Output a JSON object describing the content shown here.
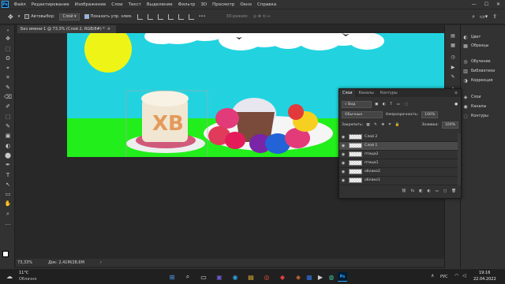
{
  "app": {
    "logo": "Ps"
  },
  "menu": [
    "Файл",
    "Редактирование",
    "Изображение",
    "Слои",
    "Текст",
    "Выделение",
    "Фильтр",
    "3D",
    "Просмотр",
    "Окно",
    "Справка"
  ],
  "window_controls": {
    "minimize": "—",
    "maximize": "☐",
    "close": "✕"
  },
  "options": {
    "autoselect_label": "Автовыбор:",
    "autoselect_value": "Слой",
    "transform_label": "Показать упр. элем.",
    "mode_3d": "3D-режим:"
  },
  "document_tab": {
    "title": "Без имени-1 @ 73,3% (Слой 2, RGB/8#) *",
    "close": "×"
  },
  "status": {
    "zoom": "73,33%",
    "doc": "Док: 2,41M/28,6M",
    "arrow": "›"
  },
  "tools": [
    "✥",
    "⬚",
    "ʘ",
    "⌖",
    "⌗",
    "✎",
    "⌫",
    "✐",
    "⬚",
    "✎",
    "▣",
    "◐",
    "⬤",
    "✒",
    "T",
    "↖",
    "▭",
    "✋",
    "⌕",
    "…"
  ],
  "right_panel": {
    "group1": [
      {
        "icon": "◐",
        "label": "Цвет"
      },
      {
        "icon": "▦",
        "label": "Образцы"
      }
    ],
    "group2": [
      {
        "icon": "◎",
        "label": "Обучение"
      },
      {
        "icon": "▥",
        "label": "Библиотеки"
      },
      {
        "icon": "◑",
        "label": "Коррекция"
      }
    ],
    "group3": [
      {
        "icon": "◈",
        "label": "Слои"
      },
      {
        "icon": "◉",
        "label": "Каналы"
      },
      {
        "icon": "◌",
        "label": "Контуры"
      }
    ]
  },
  "layers_panel": {
    "tabs": [
      "Слои",
      "Каналы",
      "Контуры"
    ],
    "menu_icon": "≡",
    "filter_label": "Вид",
    "blend_mode": "Обычные",
    "opacity_label": "Непрозрачность:",
    "opacity_value": "100%",
    "lock_label": "Закрепить:",
    "fill_label": "Заливка:",
    "fill_value": "100%",
    "layers": [
      {
        "name": "Слой 2",
        "selected": false
      },
      {
        "name": "Слой 1",
        "selected": true
      },
      {
        "name": "птица2",
        "selected": false
      },
      {
        "name": "птица1",
        "selected": false
      },
      {
        "name": "облако2",
        "selected": false
      },
      {
        "name": "облако1",
        "selected": false
      }
    ],
    "footer_icons": [
      "⛓",
      "fx",
      "◧",
      "◐",
      "▭",
      "▢",
      "🗑"
    ]
  },
  "taskbar": {
    "temperature": "11°C",
    "weather": "Облачно",
    "time": "19:16",
    "date": "22.04.2022",
    "lang": "РУС",
    "apps": [
      "⊞",
      "⌕",
      "▭",
      "▣",
      "◉",
      "▤",
      "◎",
      "◆",
      "◈",
      "▦",
      "▶",
      "◍",
      "Ps"
    ]
  },
  "colors": {
    "sky": "#22d3df",
    "grass": "#22ee1b",
    "sun": "#eef516",
    "ps_accent": "#31a8ff"
  }
}
